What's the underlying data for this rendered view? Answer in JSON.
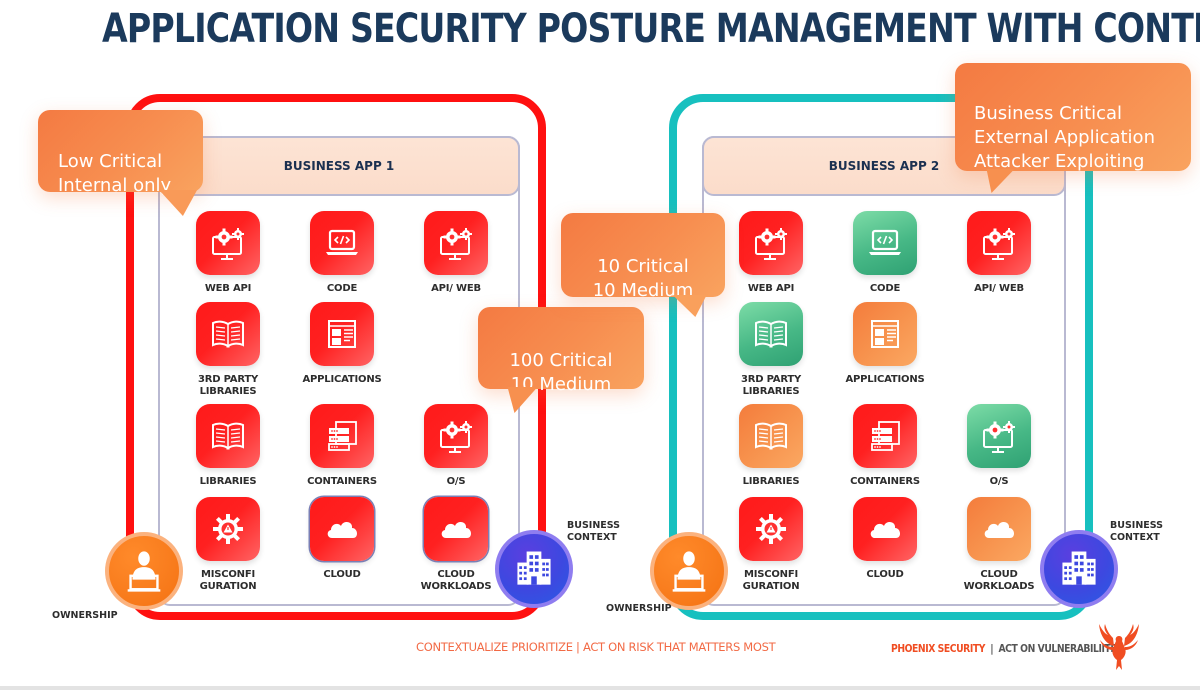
{
  "title": "APPLICATION SECURITY POSTURE MANAGEMENT WITH CONTEXT",
  "colors": {
    "title": "#1b3a5c",
    "app1_frame": "#ff1010",
    "app2_frame": "#17c0bf",
    "risk_high": "#ff2020",
    "risk_medium": "#f7924d",
    "risk_low": "#47b886",
    "callout": "#f78e50",
    "owner": "#f97d1e",
    "business": "#3d48e0"
  },
  "apps": [
    {
      "name": "BUSINESS APP 1",
      "tiles": [
        {
          "label": "WEB API",
          "icon": "monitor-gears-icon",
          "risk": "high"
        },
        {
          "label": "CODE",
          "icon": "laptop-code-icon",
          "risk": "high"
        },
        {
          "label": "API/ WEB",
          "icon": "monitor-gears-icon",
          "risk": "high"
        },
        {
          "label": "3RD PARTY\nLIBRARIES",
          "icon": "open-book-icon",
          "risk": "high"
        },
        {
          "label": "APPLICATIONS",
          "icon": "app-window-icon",
          "risk": "high"
        },
        {
          "label": "LIBRARIES",
          "icon": "open-book-icon",
          "risk": "high"
        },
        {
          "label": "CONTAINERS",
          "icon": "server-stack-icon",
          "risk": "high"
        },
        {
          "label": "O/S",
          "icon": "monitor-gears-icon",
          "risk": "high"
        },
        {
          "label": "MISCONFI\nGURATION",
          "icon": "gear-warning-icon",
          "risk": "high"
        },
        {
          "label": "CLOUD",
          "icon": "cloud-icon",
          "risk": "high"
        },
        {
          "label": "CLOUD\nWORKLOADS",
          "icon": "cloud-icon",
          "risk": "high"
        }
      ],
      "ownership_label": "OWNERSHIP",
      "business_context_label": "BUSINESS\nCONTEXT"
    },
    {
      "name": "BUSINESS APP 2",
      "tiles": [
        {
          "label": "WEB API",
          "icon": "monitor-gears-icon",
          "risk": "high"
        },
        {
          "label": "CODE",
          "icon": "laptop-code-icon",
          "risk": "low"
        },
        {
          "label": "API/ WEB",
          "icon": "monitor-gears-icon",
          "risk": "high"
        },
        {
          "label": "3RD PARTY\nLIBRARIES",
          "icon": "open-book-icon",
          "risk": "low"
        },
        {
          "label": "APPLICATIONS",
          "icon": "app-window-icon",
          "risk": "medium"
        },
        {
          "label": "LIBRARIES",
          "icon": "open-book-icon",
          "risk": "medium"
        },
        {
          "label": "CONTAINERS",
          "icon": "server-stack-icon",
          "risk": "high"
        },
        {
          "label": "O/S",
          "icon": "monitor-gears-icon",
          "risk": "low"
        },
        {
          "label": "MISCONFI\nGURATION",
          "icon": "gear-warning-icon",
          "risk": "high"
        },
        {
          "label": "CLOUD",
          "icon": "cloud-icon",
          "risk": "high"
        },
        {
          "label": "CLOUD\nWORKLOADS",
          "icon": "cloud-icon",
          "risk": "medium"
        }
      ],
      "ownership_label": "OWNERSHIP",
      "business_context_label": "BUSINESS\nCONTEXT"
    }
  ],
  "callouts": {
    "app1_context": "Low Critical\nInternal only",
    "app1_findings": "100 Critical\n10 Medium",
    "app2_findings": "10 Critical\n10 Medium",
    "app2_context": "Business Critical\nExternal Application\nAttacker Exploiting"
  },
  "footer": {
    "tagline": "CONTEXTUALIZE PRIORITIZE |  ACT ON RISK THAT MATTERS MOST",
    "brand": "PHOENIX SECURITY",
    "separator": "|",
    "brand_tagline": "ACT ON VULNERABILIITES",
    "logo_icon": "phoenix-bird-icon"
  }
}
